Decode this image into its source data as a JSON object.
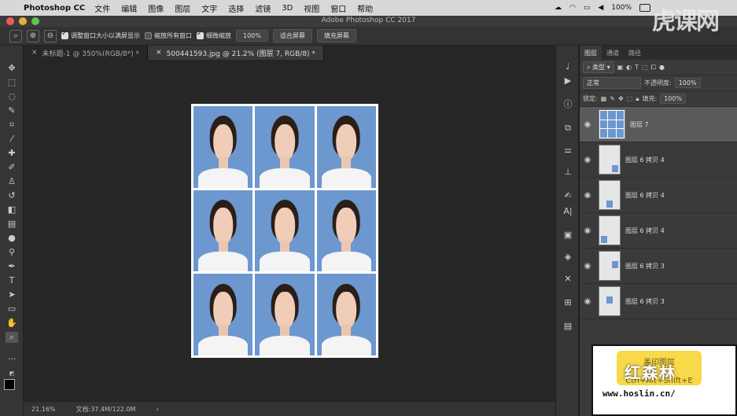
{
  "menubar": {
    "app_name": "Photoshop CC",
    "items": [
      "文件",
      "编辑",
      "图像",
      "图层",
      "文字",
      "选择",
      "滤镜",
      "3D",
      "视图",
      "窗口",
      "帮助"
    ],
    "battery": "100%"
  },
  "window": {
    "title": "Adobe Photoshop CC 2017"
  },
  "options": {
    "resize_windows_label": "调整窗口大小以满屏显示",
    "zoom_all_windows_label": "缩放所有窗口",
    "scrubby_zoom_label": "细微缩放",
    "zoom_value": "100%",
    "fit_screen_label": "适合屏幕",
    "fill_screen_label": "填充屏幕"
  },
  "tabs": [
    {
      "label": "未标题-1 @ 350%(RGB/8*) *"
    },
    {
      "label": "500441593.jpg @ 21.2% (图层 7, RGB/8) *"
    }
  ],
  "status": {
    "zoom": "21.16%",
    "doc_info": "文档:37.4M/122.0M",
    "arrow": "›"
  },
  "layers_panel": {
    "tabs": [
      "图层",
      "通道",
      "路径"
    ],
    "filter_label": "类型",
    "blend_mode": "正常",
    "opacity_label": "不透明度:",
    "opacity_value": "100%",
    "lock_label": "锁定:",
    "fill_label": "填充:",
    "fill_value": "100%",
    "layers": [
      {
        "name": "图层 7"
      },
      {
        "name": "图层 6 拷贝 4"
      },
      {
        "name": "图层 6 拷贝 4"
      },
      {
        "name": "图层 6 拷贝 4"
      },
      {
        "name": "图层 6 拷贝 3"
      },
      {
        "name": "图层 6 拷贝 3"
      }
    ]
  },
  "overlay": {
    "note_line1": "盖印图层",
    "note_line2": "Ctrl+Alt+Shift+E",
    "brand": "红森林",
    "url": "www.hoslin.cn/"
  },
  "watermark": {
    "logo_text": "虎课网"
  }
}
